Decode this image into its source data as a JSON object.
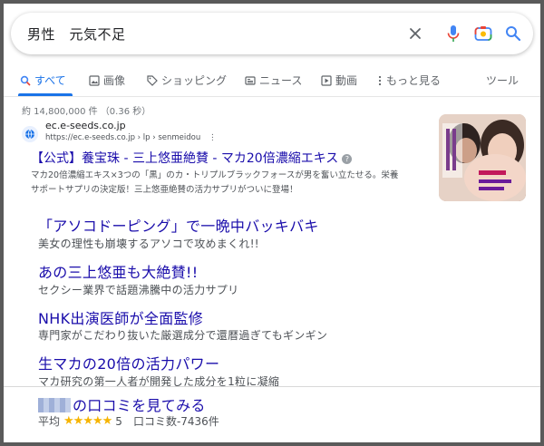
{
  "search": {
    "query": "男性　元気不足"
  },
  "tabs": [
    {
      "label": "すべて",
      "icon": "search-icon"
    },
    {
      "label": "画像",
      "icon": "image-icon"
    },
    {
      "label": "ショッピング",
      "icon": "tag-icon"
    },
    {
      "label": "ニュース",
      "icon": "news-icon"
    },
    {
      "label": "動画",
      "icon": "video-icon"
    },
    {
      "label": "もっと見る",
      "icon": "more-icon"
    },
    {
      "label": "ツール"
    }
  ],
  "results_stats": "約 14,800,000 件 （0.36 秒）",
  "ad": {
    "domain": "ec.e-seeds.co.jp",
    "breadcrumb": "https://ec.e-seeds.co.jp › lp › senmeidou",
    "title": "【公式】養宝珠 - 三上悠亜絶賛 - マカ20倍濃縮エキス",
    "description_line1": "マカ20倍濃縮エキス×3つの「黒」のカ・トリプルブラックフォースが男を奮い立たせる。栄養",
    "description_line2": "サポートサプリの決定版！三上悠亜絶賛の活力サプリがついに登場！"
  },
  "sitelinks": [
    {
      "title": "「アソコドーピング」で一晩中バッキバキ",
      "desc": "美女の理性も崩壊するアソコで攻めまくれ!!"
    },
    {
      "title": "あの三上悠亜も大絶賛!!",
      "desc": "セクシー業界で話題沸騰中の活力サプリ"
    },
    {
      "title": "NHK出演医師が全面監修",
      "desc": "専門家がこだわり抜いた厳選成分で還暦過ぎてもギンギン"
    },
    {
      "title": "生マカの20倍の活力パワー",
      "desc": "マカ研究の第一人者が開発した成分を1粒に凝縮"
    },
    {
      "title": "の口コミを見てみる",
      "desc": ""
    }
  ],
  "rating": {
    "prefix": "平均",
    "stars": "★★★★★",
    "score": "5",
    "count": "口コミ数-7436件"
  },
  "colors": {
    "link": "#1a0dab",
    "accent": "#1a73e8",
    "star": "#f6b400"
  }
}
